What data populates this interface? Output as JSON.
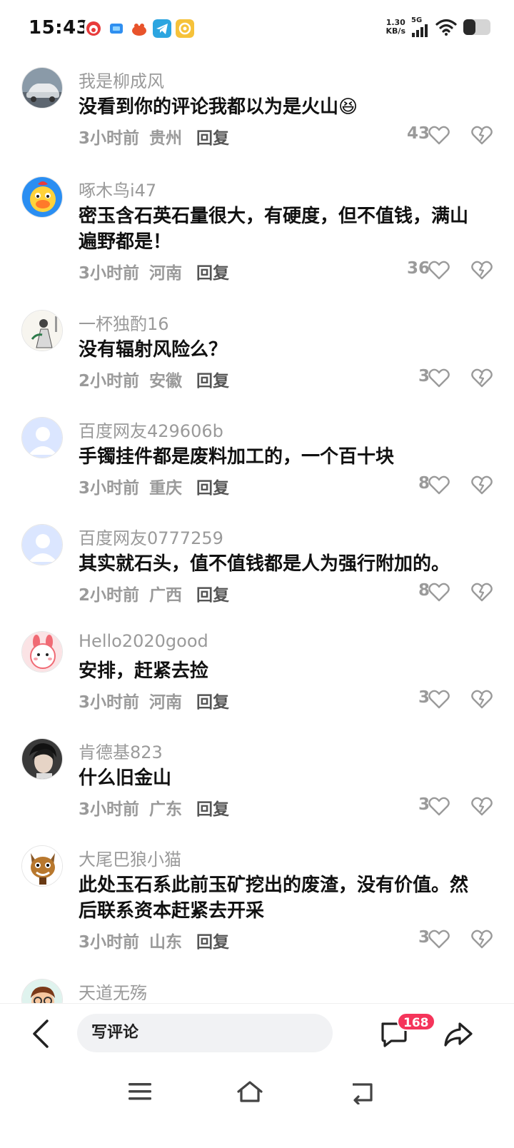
{
  "status_bar": {
    "time": "15:43",
    "net_speed_value": "1.30",
    "net_speed_unit": "KB/s",
    "network_type": "5G",
    "app_icons": [
      "clown-app-icon",
      "blue-app-icon",
      "orange-app-icon",
      "telegram-icon",
      "yellow-app-icon"
    ],
    "battery_level_percent": 45
  },
  "comments": [
    {
      "username": "我是柳成风",
      "text": "没看到你的评论我都以为是火山",
      "emoji": "😆",
      "time": "3小时前",
      "location": "贵州",
      "reply": "回复",
      "likes": "43",
      "avatar": "car"
    },
    {
      "username": "啄木鸟i47",
      "text": "密玉含石英石量很大，有硬度，但不值钱，满山遍野都是！",
      "emoji": "",
      "time": "3小时前",
      "location": "河南",
      "reply": "回复",
      "likes": "36",
      "avatar": "duck"
    },
    {
      "username": "一杯独酌16",
      "text": "没有辐射风险么？",
      "emoji": "",
      "time": "2小时前",
      "location": "安徽",
      "reply": "回复",
      "likes": "3",
      "avatar": "ink"
    },
    {
      "username": "百度网友429606b",
      "text": "手镯挂件都是废料加工的，一个百十块",
      "emoji": "",
      "time": "3小时前",
      "location": "重庆",
      "reply": "回复",
      "likes": "8",
      "avatar": "default"
    },
    {
      "username": "百度网友0777259",
      "text": "其实就石头，值不值钱都是人为强行附加的。",
      "emoji": "",
      "time": "2小时前",
      "location": "广西",
      "reply": "回复",
      "likes": "8",
      "avatar": "default"
    },
    {
      "username": "Hello2020good",
      "text": "安排，赶紧去捡",
      "emoji": "",
      "time": "3小时前",
      "location": "河南",
      "reply": "回复",
      "likes": "3",
      "avatar": "bunny"
    },
    {
      "username": "肯德基823",
      "text": "什么旧金山",
      "emoji": "",
      "time": "3小时前",
      "location": "广东",
      "reply": "回复",
      "likes": "3",
      "avatar": "person"
    },
    {
      "username": "大尾巴狼小猫",
      "text": "此处玉石系此前玉矿挖出的废渣，没有价值。然后联系资本赶紧去开采",
      "emoji": "",
      "time": "3小时前",
      "location": "山东",
      "reply": "回复",
      "likes": "3",
      "avatar": "cat"
    },
    {
      "username": "天道无殇",
      "text": "",
      "emoji": "",
      "time": "",
      "location": "",
      "reply": "",
      "likes": "",
      "avatar": "cartoon"
    }
  ],
  "bottom_bar": {
    "comment_placeholder": "写评论",
    "comment_count": "168"
  },
  "colors": {
    "badge": "#f5345a",
    "secondary_text": "#9a9a9a",
    "primary_text": "#111111"
  }
}
